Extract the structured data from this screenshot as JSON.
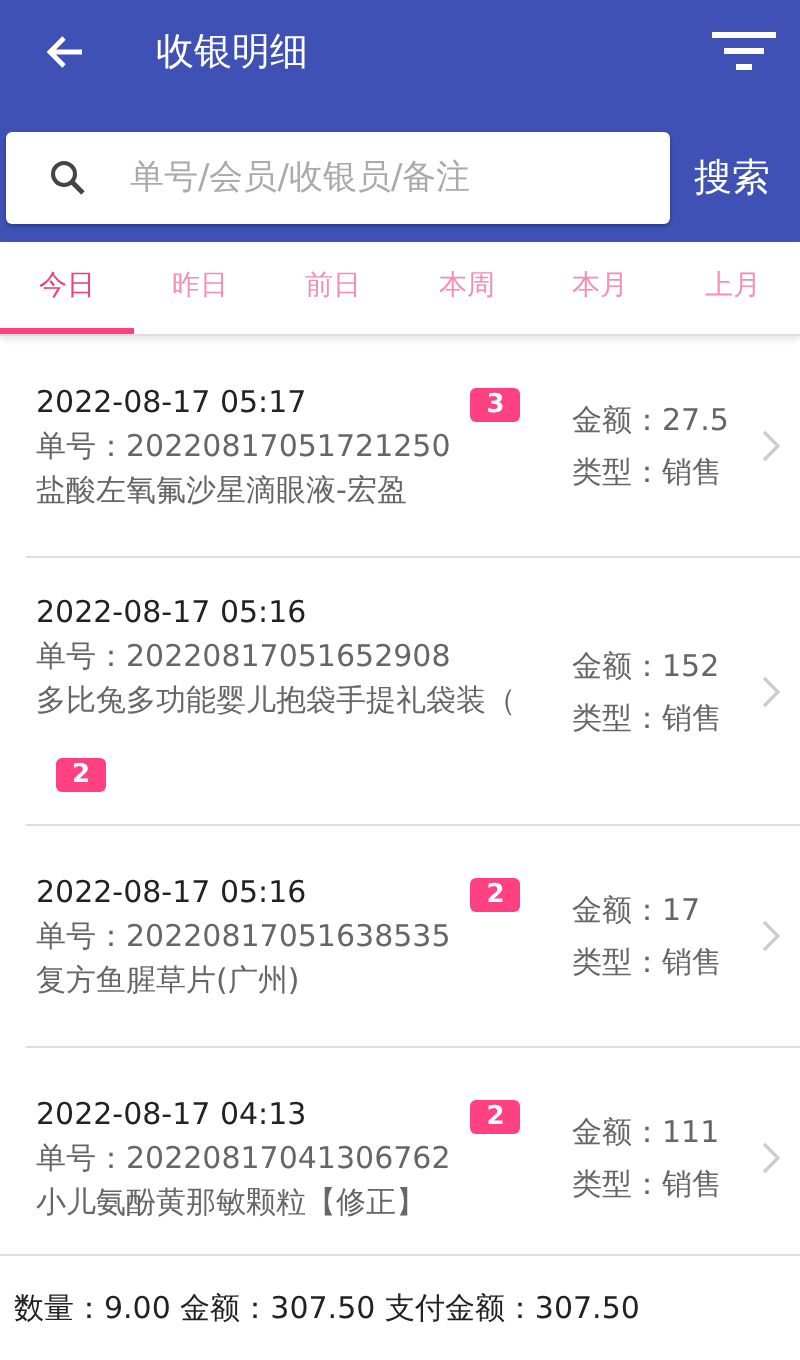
{
  "header": {
    "title": "收银明细"
  },
  "search": {
    "placeholder": "单号/会员/收银员/备注",
    "button": "搜索"
  },
  "tabs": [
    {
      "label": "今日",
      "selected": true
    },
    {
      "label": "昨日",
      "selected": false
    },
    {
      "label": "前日",
      "selected": false
    },
    {
      "label": "本周",
      "selected": false
    },
    {
      "label": "本月",
      "selected": false
    },
    {
      "label": "上月",
      "selected": false
    }
  ],
  "orders": [
    {
      "time": "2022-08-17 05:17",
      "number": "单号：20220817051721250",
      "item": "盐酸左氧氟沙星滴眼液-宏盈",
      "count": "3",
      "amount": "金额：27.5",
      "type": "类型：销售"
    },
    {
      "time": "2022-08-17 05:16",
      "number": "单号：20220817051652908",
      "item": "多比兔多功能婴儿抱袋手提礼袋装（",
      "count": "2",
      "amount": "金额：152",
      "type": "类型：销售"
    },
    {
      "time": "2022-08-17 05:16",
      "number": "单号：20220817051638535",
      "item": "复方鱼腥草片(广州)",
      "count": "2",
      "amount": "金额：17",
      "type": "类型：销售"
    },
    {
      "time": "2022-08-17 04:13",
      "number": "单号：20220817041306762",
      "item": "小儿氨酚黄那敏颗粒【修正】",
      "count": "2",
      "amount": "金额：111",
      "type": "类型：销售"
    }
  ],
  "summary": "数量：9.00 金额：307.50 支付金额：307.50"
}
